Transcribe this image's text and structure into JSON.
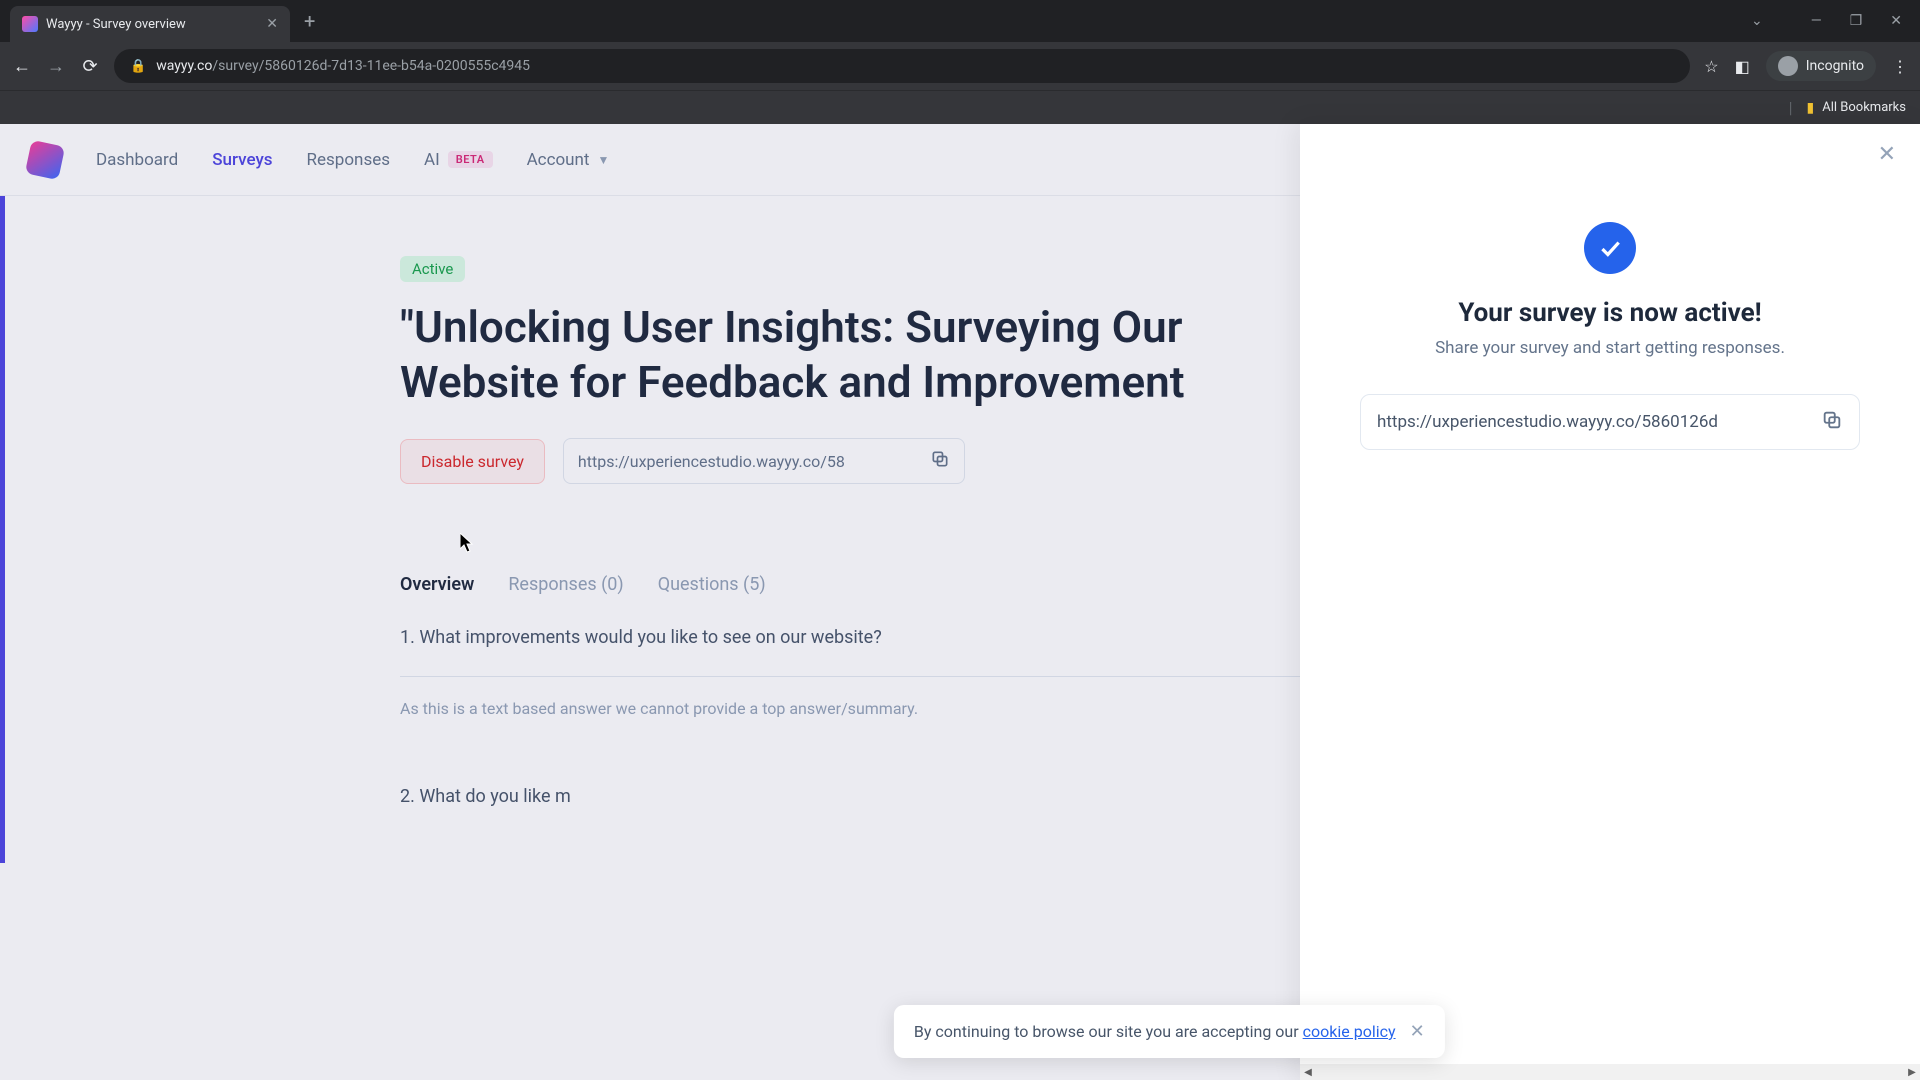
{
  "browser": {
    "tab_title": "Wayyy - Survey overview",
    "url_domain": "wayyy.co",
    "url_path": "/survey/5860126d-7d13-11ee-b54a-0200555c4945",
    "incognito_label": "Incognito",
    "bookmarks_label": "All Bookmarks"
  },
  "nav": {
    "dashboard": "Dashboard",
    "surveys": "Surveys",
    "responses": "Responses",
    "ai": "AI",
    "beta": "BETA",
    "account": "Account"
  },
  "survey": {
    "status": "Active",
    "title_line1": "\"Unlocking User Insights: Surveying Our",
    "title_line2": "Website for Feedback and Improvement",
    "disable_label": "Disable survey",
    "share_url_short": "https://uxperiencestudio.wayyy.co/58"
  },
  "tabs": {
    "overview": "Overview",
    "responses": "Responses (0)",
    "questions": "Questions (5)"
  },
  "questions": [
    {
      "title": "1. What improvements would you like to see on our website?",
      "note": "As this is a text based answer we cannot provide a top answer/summary."
    },
    {
      "title": "2. What do you like m",
      "note": ""
    }
  ],
  "panel": {
    "title": "Your survey is now active!",
    "subtitle": "Share your survey and start getting responses.",
    "url": "https://uxperiencestudio.wayyy.co/5860126d"
  },
  "cookie": {
    "text": "By continuing to browse our site you are accepting our ",
    "link": "cookie policy"
  }
}
